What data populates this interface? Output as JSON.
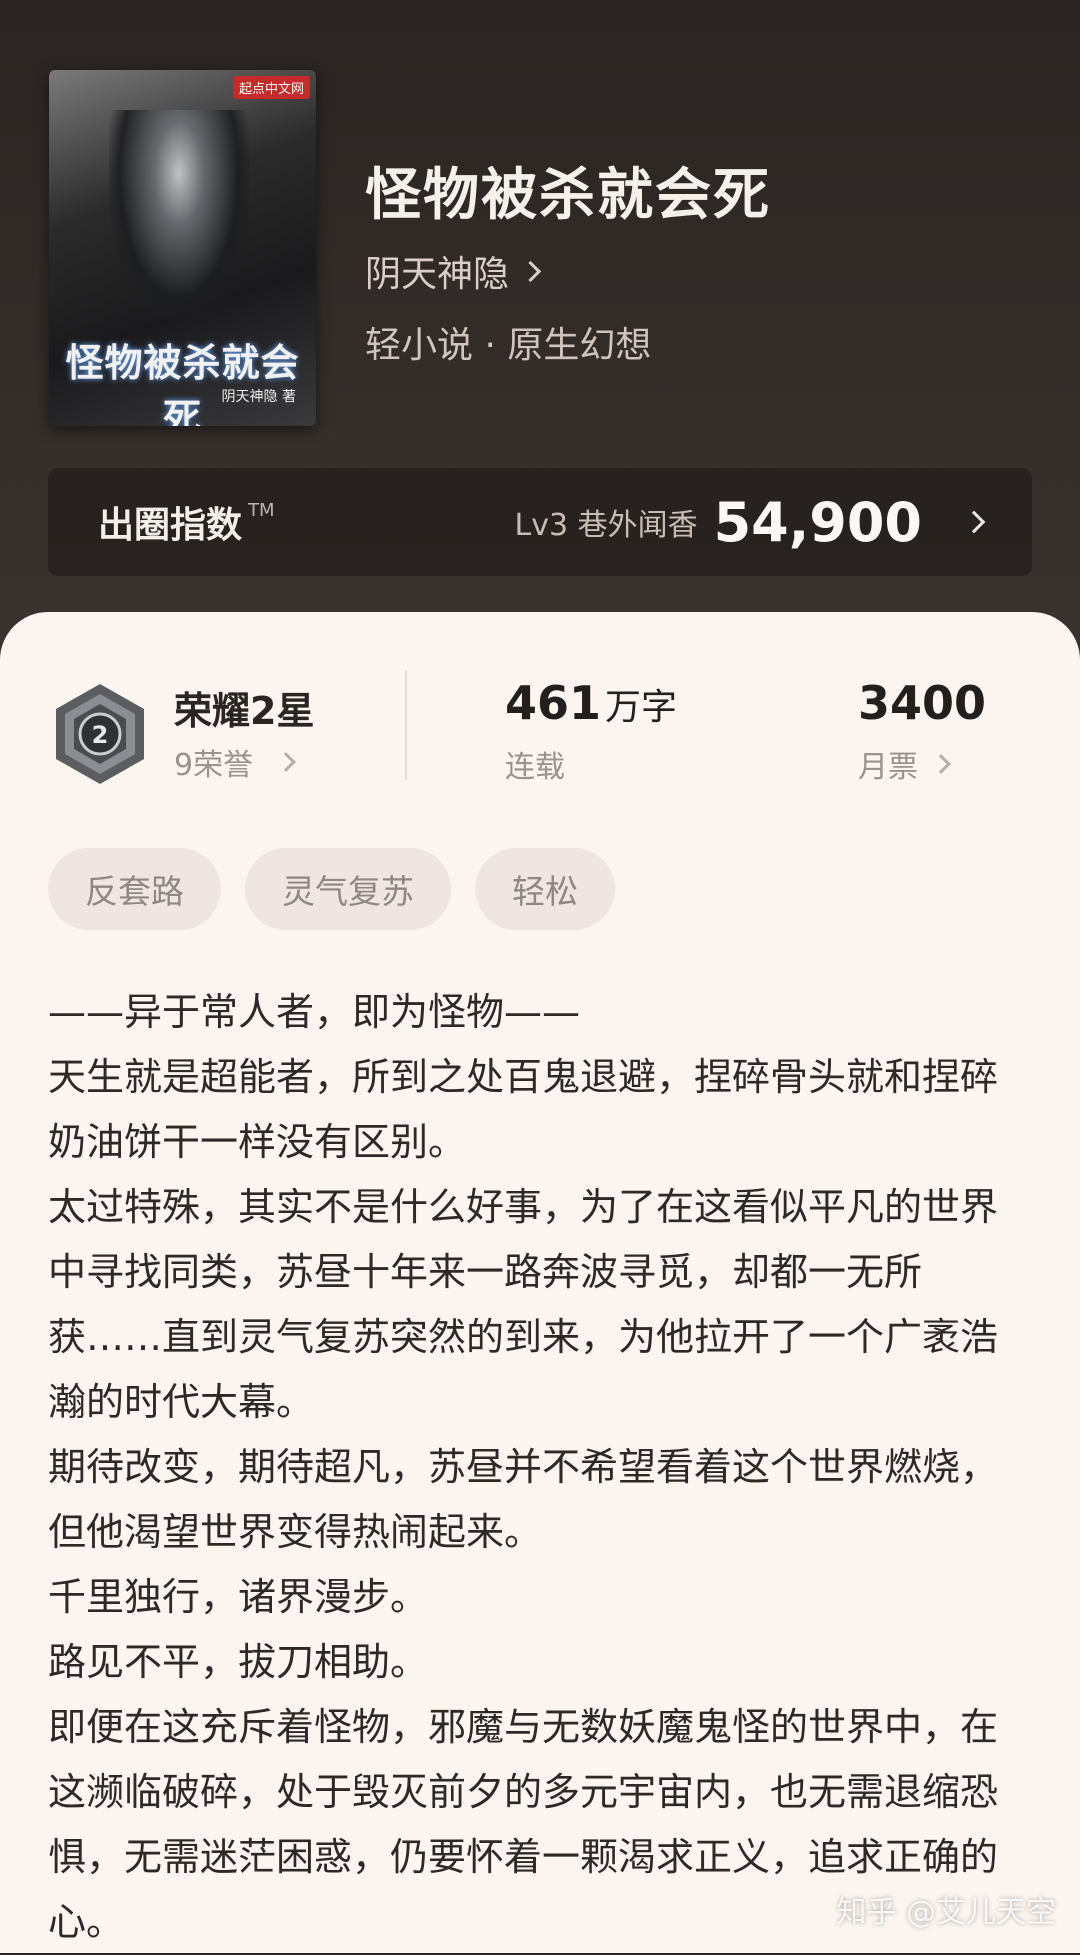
{
  "book": {
    "cover_publisher": "起点中文网",
    "cover_title": "怪物被杀就会死",
    "cover_author": "阴天神隐 著",
    "title": "怪物被杀就会死",
    "author": "阴天神隐",
    "genre": "轻小说 · 原生幻想"
  },
  "index_bar": {
    "label": "出圈指数",
    "tm": "TM",
    "level": "Lv3 巷外闻香",
    "score": "54,900"
  },
  "stats": {
    "honor_title": "荣耀2星",
    "honor_sub": "9荣誉",
    "badge_number": "2",
    "words_value": "461",
    "words_unit": "万字",
    "words_label": "连载",
    "tickets_value": "3400",
    "tickets_label": "月票"
  },
  "tags": [
    "反套路",
    "灵气复苏",
    "轻松"
  ],
  "synopsis": [
    "——异于常人者，即为怪物——",
    "天生就是超能者，所到之处百鬼退避，捏碎骨头就和捏碎奶油饼干一样没有区别。",
    "太过特殊，其实不是什么好事，为了在这看似平凡的世界中寻找同类，苏昼十年来一路奔波寻觅，却都一无所获……直到灵气复苏突然的到来，为他拉开了一个广袤浩瀚的时代大幕。",
    "期待改变，期待超凡，苏昼并不希望看着这个世界燃烧，但他渴望世界变得热闹起来。",
    "千里独行，诸界漫步。",
    "路见不平，拔刀相助。",
    "即便在这充斥着怪物，邪魔与无数妖魔鬼怪的世界中，在这濒临破碎，处于毁灭前夕的多元宇宙内，也无需退缩恐惧，无需迷茫困惑，仍要怀着一颗渴求正义，追求正确的心。"
  ],
  "watermark": "知乎 @艾儿天空",
  "colors": {
    "header_bg": "#2a2422",
    "sheet_bg": "#fbf4ef",
    "tag_bg": "#efe6e1"
  }
}
